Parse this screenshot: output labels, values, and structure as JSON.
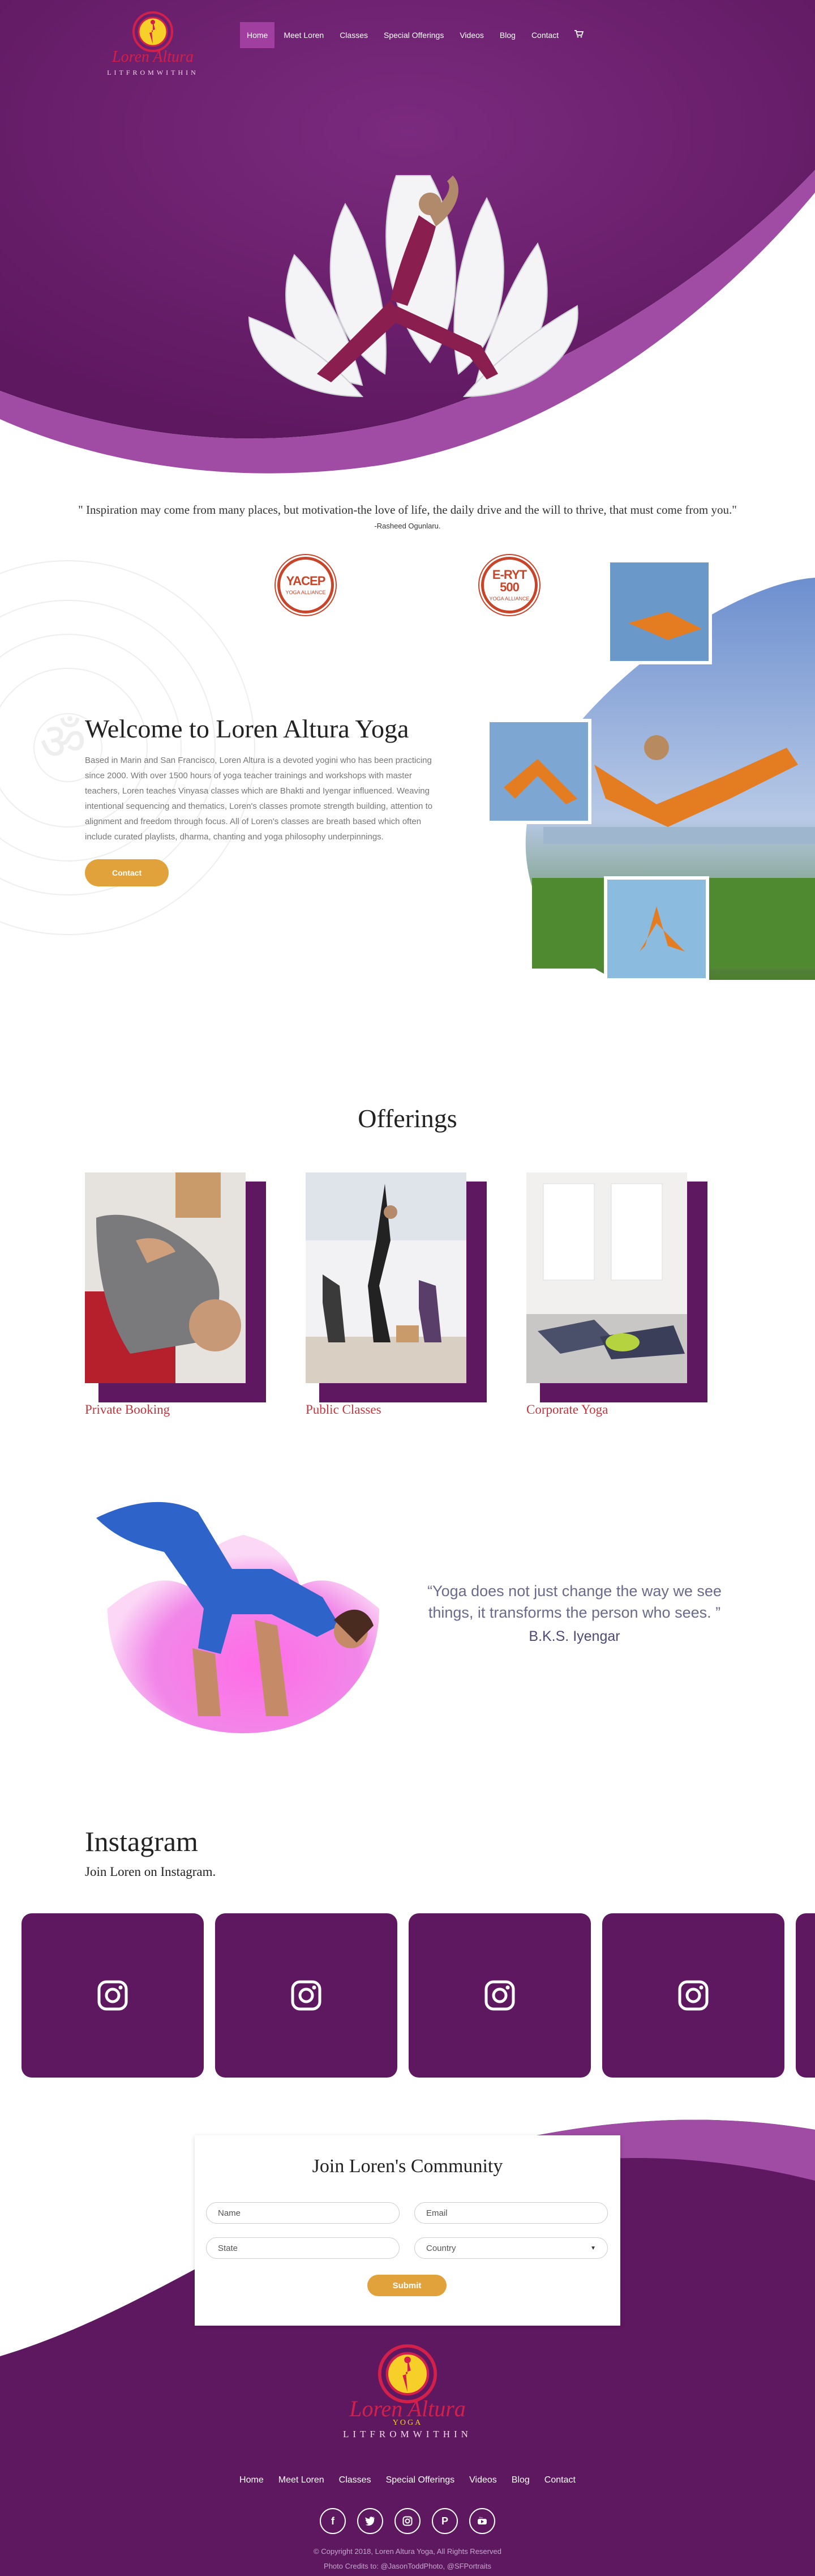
{
  "header": {
    "logo": {
      "name": "Loren Altura",
      "tagline": "LITFROMWITHIN"
    },
    "nav": [
      {
        "label": "Home",
        "active": true
      },
      {
        "label": "Meet Loren"
      },
      {
        "label": "Classes"
      },
      {
        "label": "Special Offerings"
      },
      {
        "label": "Videos"
      },
      {
        "label": "Blog"
      },
      {
        "label": "Contact"
      }
    ],
    "cart_icon": "cart-icon"
  },
  "quote": {
    "text": "\" Inspiration may come from many places, but motivation-the love of life, the daily drive and the will to thrive, that must come from you.\"",
    "author": "-Rasheed Ogunlaru."
  },
  "badges": [
    {
      "title": "YACEP",
      "sub": "YOGA ALLIANCE"
    },
    {
      "title": "E-RYT 500",
      "sub": "YOGA ALLIANCE"
    }
  ],
  "welcome": {
    "title": "Welcome to Loren Altura Yoga",
    "body": "Based in Marin and San Francisco, Loren Altura is a devoted yogini who has been practicing since 2000. With over 1500 hours of yoga teacher trainings and workshops with master teachers, Loren teaches Vinyasa classes which are Bhakti and Iyengar influenced. Weaving intentional sequencing and thematics, Loren's classes promote strength building, attention to alignment and freedom through focus. All of Loren's classes are breath based which often include curated playlists, dharma, chanting and yoga philosophy underpinnings.",
    "button": "Contact"
  },
  "offerings": {
    "title": "Offerings",
    "items": [
      {
        "label": "Private Booking"
      },
      {
        "label": "Public Classes"
      },
      {
        "label": "Corporate Yoga"
      }
    ]
  },
  "yoga_quote": {
    "text": "“Yoga does not just change the way we see things, it transforms the person who sees. ”",
    "author": "B.K.S. Iyengar"
  },
  "instagram": {
    "title": "Instagram",
    "subtitle": "Join Loren on Instagram."
  },
  "community": {
    "title": "Join Loren's Community",
    "name_placeholder": "Name",
    "email_placeholder": "Email",
    "state_placeholder": "State",
    "country_value": "Country",
    "submit": "Submit"
  },
  "footer": {
    "logo_name": "Loren Altura",
    "logo_sub": "YOGA",
    "tagline": "LITFROMWITHIN",
    "nav": [
      "Home",
      "Meet Loren",
      "Classes",
      "Special Offerings",
      "Videos",
      "Blog",
      "Contact"
    ],
    "social": [
      "facebook-icon",
      "twitter-icon",
      "instagram-icon",
      "pinterest-icon",
      "youtube-icon"
    ],
    "copyright": "© Copyright 2018, Loren Altura Yoga, All Rights Reserved",
    "credits": "Photo Credits to: @JasonToddPhoto, @SFPortraits"
  },
  "colors": {
    "purple": "#5e1860",
    "purple_light": "#a04ba4",
    "accent_orange": "#e2a23b",
    "accent_red": "#c7343d"
  }
}
